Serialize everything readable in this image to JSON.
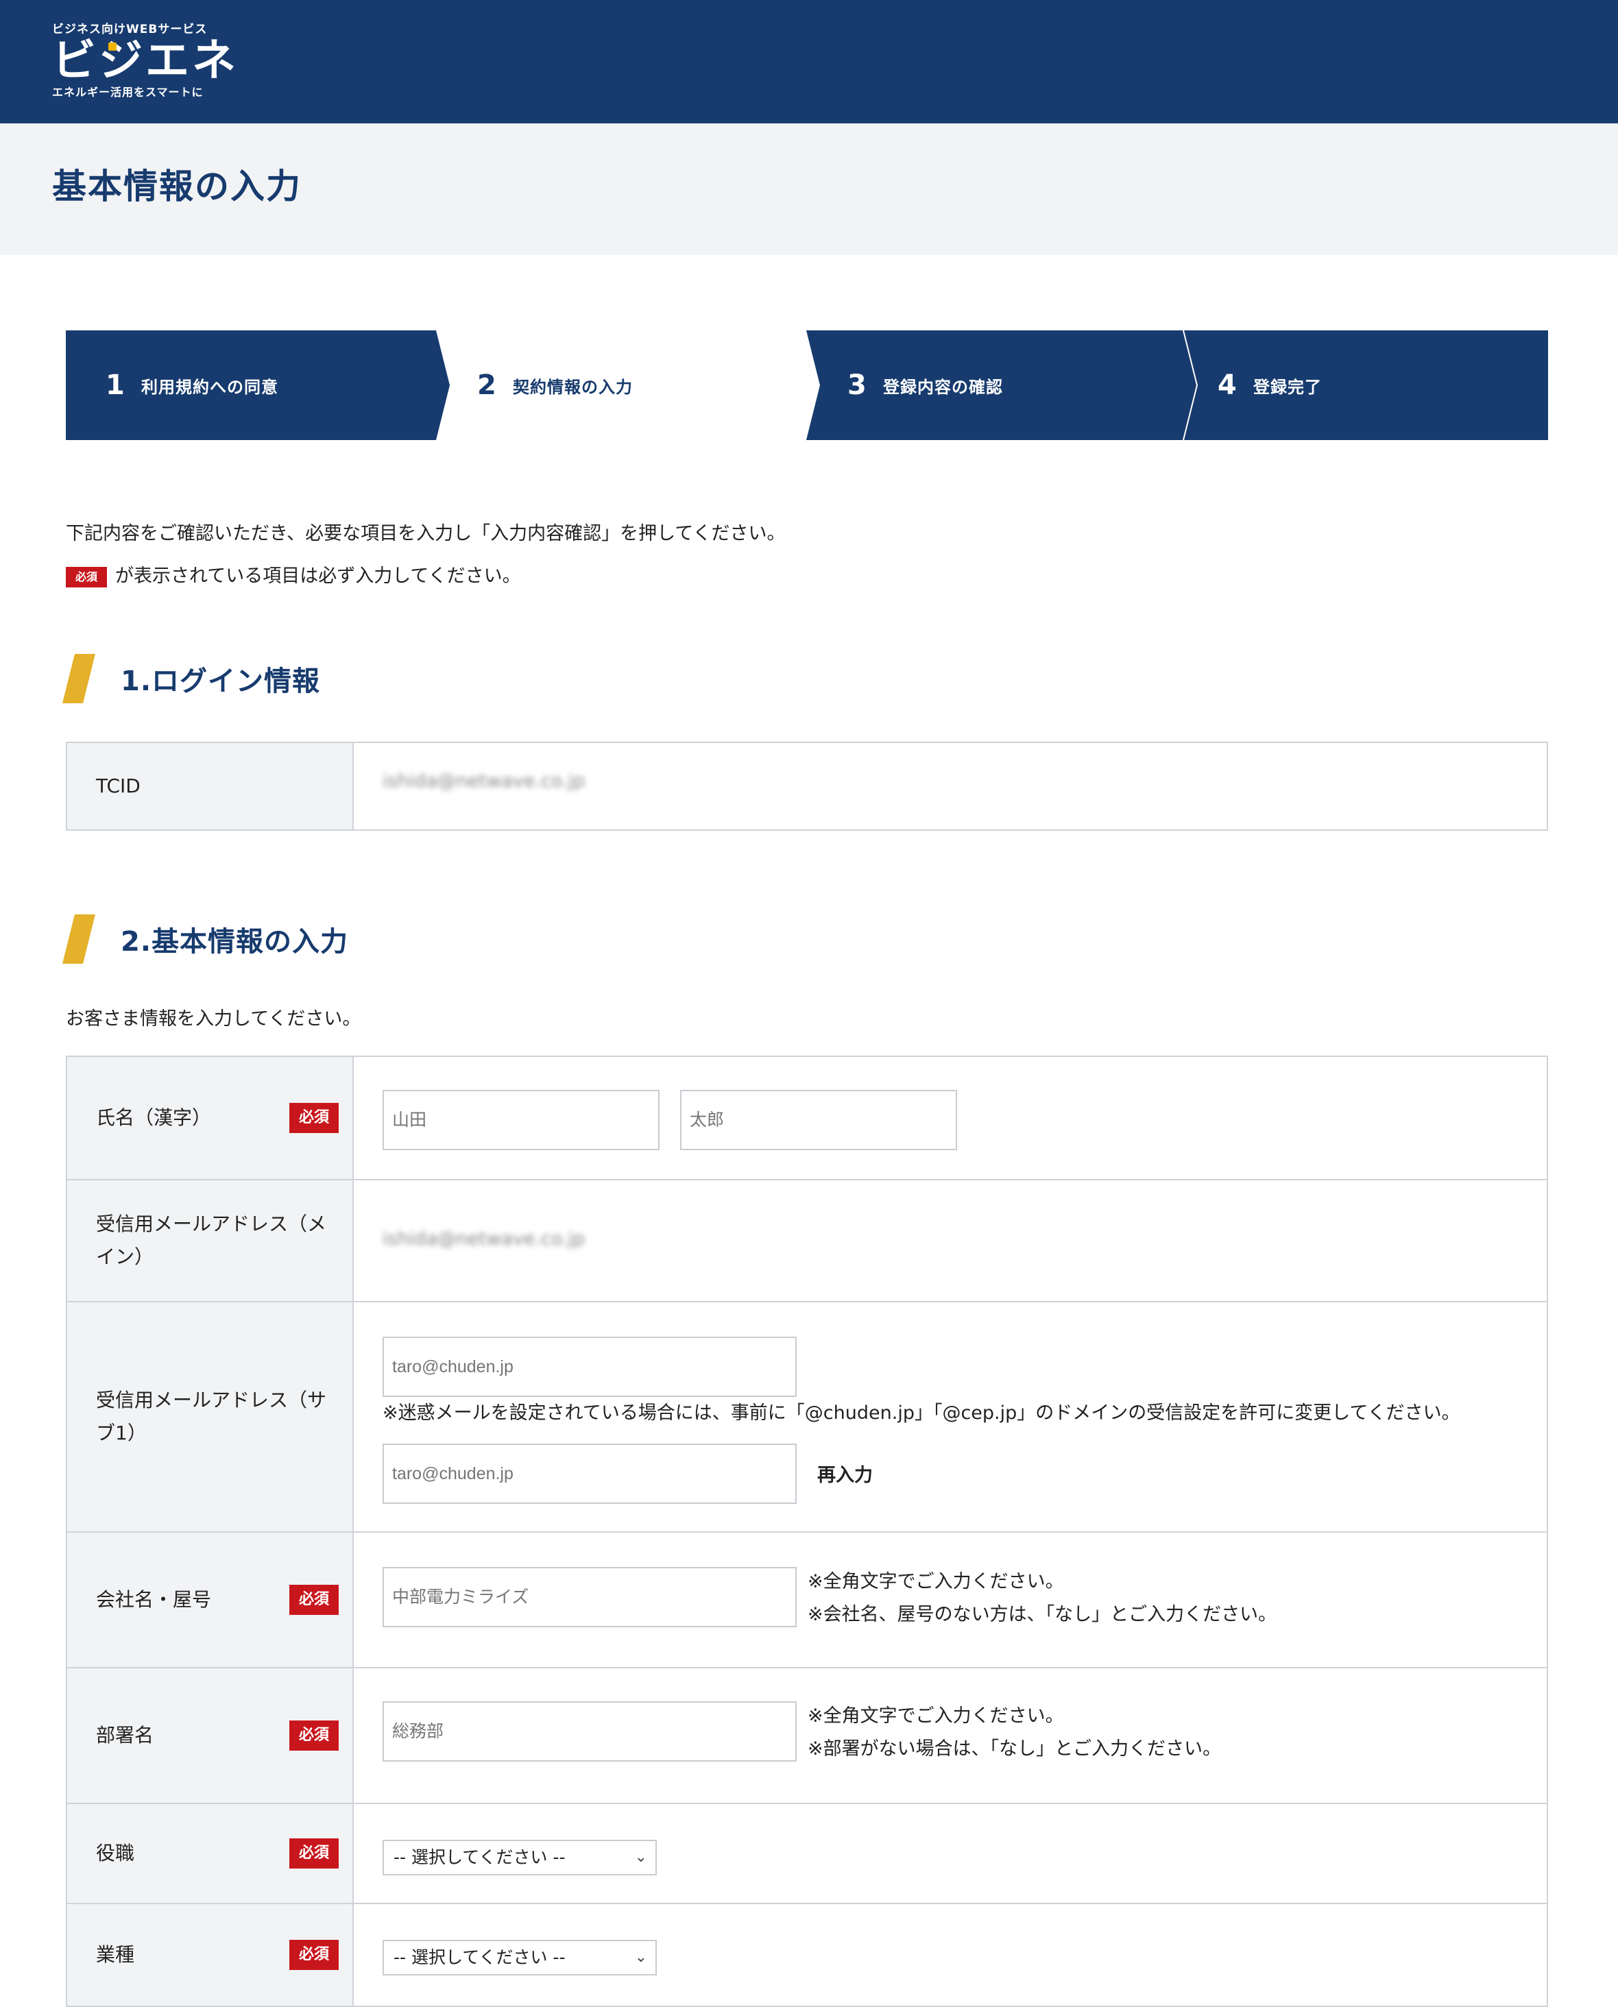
{
  "header": {
    "logo_top": "ビジネス向けWEBサービス",
    "logo_main": "ビジエネ",
    "logo_bottom": "エネルギー活用をスマートに"
  },
  "page_title": "基本情報の入力",
  "steps": [
    {
      "num": "1",
      "label": "利用規約への同意"
    },
    {
      "num": "2",
      "label": "契約情報の入力"
    },
    {
      "num": "3",
      "label": "登録内容の確認"
    },
    {
      "num": "4",
      "label": "登録完了"
    }
  ],
  "intro": {
    "line1": "下記内容をご確認いただき、必要な項目を入力し「入力内容確認」を押してください。",
    "required_badge": "必須",
    "line2": "が表示されている項目は必ず入力してください。"
  },
  "section1": {
    "title": "1.ログイン情報",
    "tcid_label": "TCID",
    "tcid_value": "ishida@netwave.co.jp"
  },
  "section2": {
    "title": "2.基本情報の入力",
    "description": "お客さま情報を入力してください。",
    "required": "必須",
    "name": {
      "label": "氏名（漢字）",
      "last_placeholder": "山田",
      "first_placeholder": "太郎"
    },
    "email_main": {
      "label_l1": "受信用メールアドレス（メ",
      "label_l2": "イン）",
      "value": "ishida@netwave.co.jp"
    },
    "email_sub": {
      "label_l1": "受信用メールアドレス（サ",
      "label_l2": "ブ1）",
      "placeholder": "taro@chuden.jp",
      "note": "※迷惑メールを設定されている場合には、事前に「@chuden.jp」「@cep.jp」のドメインの受信設定を許可に変更してください。",
      "confirm_placeholder": "taro@chuden.jp",
      "reinput_label": "再入力"
    },
    "company": {
      "label": "会社名・屋号",
      "placeholder": "中部電力ミライズ",
      "note1": "※全角文字でご入力ください。",
      "note2": "※会社名、屋号のない方は、「なし」とご入力ください。"
    },
    "department": {
      "label": "部署名",
      "placeholder": "総務部",
      "note1": "※全角文字でご入力ください。",
      "note2": "※部署がない場合は、「なし」とご入力ください。"
    },
    "position": {
      "label": "役職",
      "selected": "-- 選択してください --"
    },
    "industry": {
      "label": "業種",
      "selected": "-- 選択してください --"
    }
  },
  "colors": {
    "navy": "#173b6e",
    "accent_yellow": "#e5b12b",
    "required_red": "#c8161d",
    "band_gray": "#f2f3f5"
  }
}
